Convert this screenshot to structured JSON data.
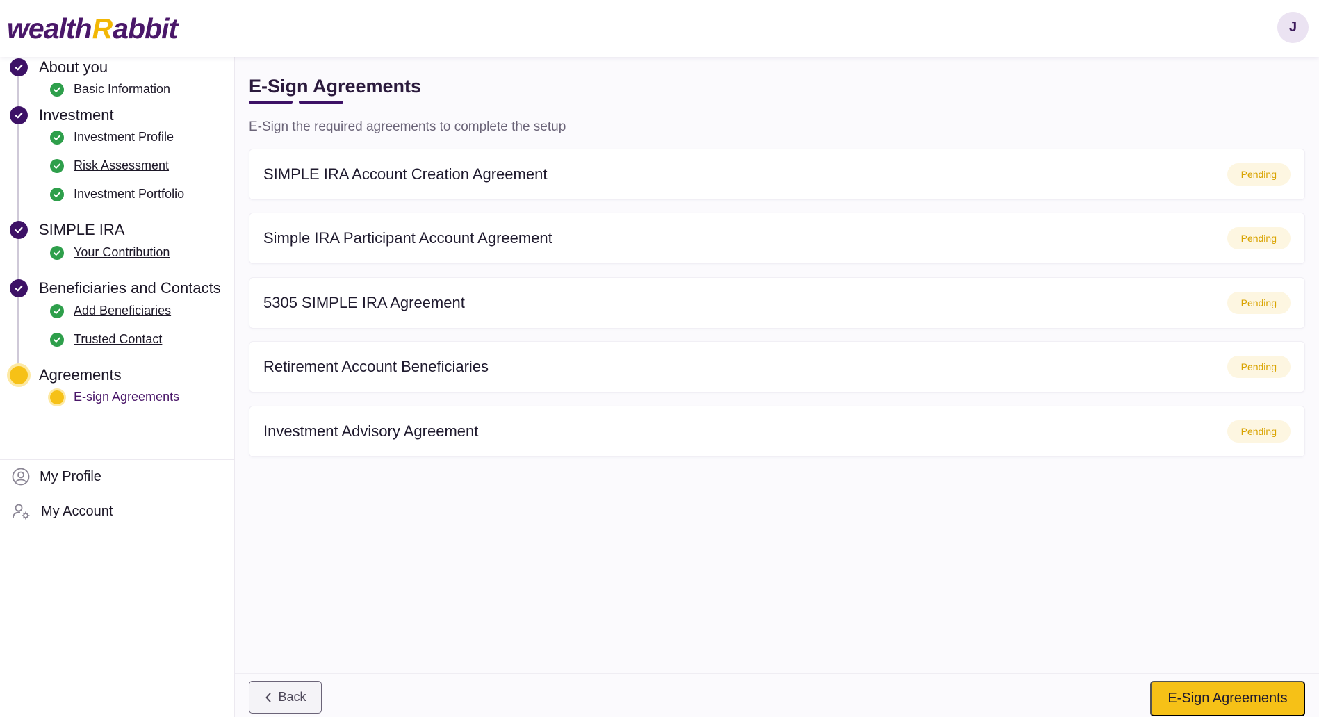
{
  "header": {
    "logo_part1": "wealth",
    "logo_r": "R",
    "logo_part2": "abbit",
    "avatar_initial": "J"
  },
  "sidebar": {
    "steps": [
      {
        "label": "About you",
        "status": "complete",
        "substeps": [
          {
            "label": "Basic Information",
            "status": "complete"
          }
        ]
      },
      {
        "label": "Investment",
        "status": "complete",
        "substeps": [
          {
            "label": "Investment Profile",
            "status": "complete"
          },
          {
            "label": "Risk Assessment",
            "status": "complete"
          },
          {
            "label": "Investment Portfolio",
            "status": "complete"
          }
        ]
      },
      {
        "label": "SIMPLE IRA",
        "status": "complete",
        "substeps": [
          {
            "label": "Your Contribution",
            "status": "complete"
          }
        ]
      },
      {
        "label": "Beneficiaries and Contacts",
        "status": "complete",
        "substeps": [
          {
            "label": "Add Beneficiaries",
            "status": "complete"
          },
          {
            "label": "Trusted Contact",
            "status": "complete"
          }
        ]
      },
      {
        "label": "Agreements",
        "status": "current",
        "substeps": [
          {
            "label": "E-sign Agreements",
            "status": "current"
          }
        ]
      }
    ],
    "links": [
      {
        "label": "My Profile",
        "icon": "user-circle-icon"
      },
      {
        "label": "My Account",
        "icon": "user-gear-icon"
      }
    ]
  },
  "main": {
    "title": "E-Sign Agreements",
    "subtitle": "E-Sign the required agreements to complete the setup",
    "agreements": [
      {
        "name": "SIMPLE IRA Account Creation Agreement",
        "status": "Pending"
      },
      {
        "name": "Simple IRA Participant Account Agreement",
        "status": "Pending"
      },
      {
        "name": "5305 SIMPLE IRA Agreement",
        "status": "Pending"
      },
      {
        "name": "Retirement Account Beneficiaries",
        "status": "Pending"
      },
      {
        "name": "Investment Advisory Agreement",
        "status": "Pending"
      }
    ]
  },
  "footer": {
    "back_label": "Back",
    "primary_label": "E-Sign Agreements"
  },
  "colors": {
    "brand_purple": "#3d1166",
    "brand_yellow": "#f6c117",
    "success_green": "#2e9f4b",
    "pending_text": "#d9a300",
    "pending_bg": "#fdf6e1"
  }
}
